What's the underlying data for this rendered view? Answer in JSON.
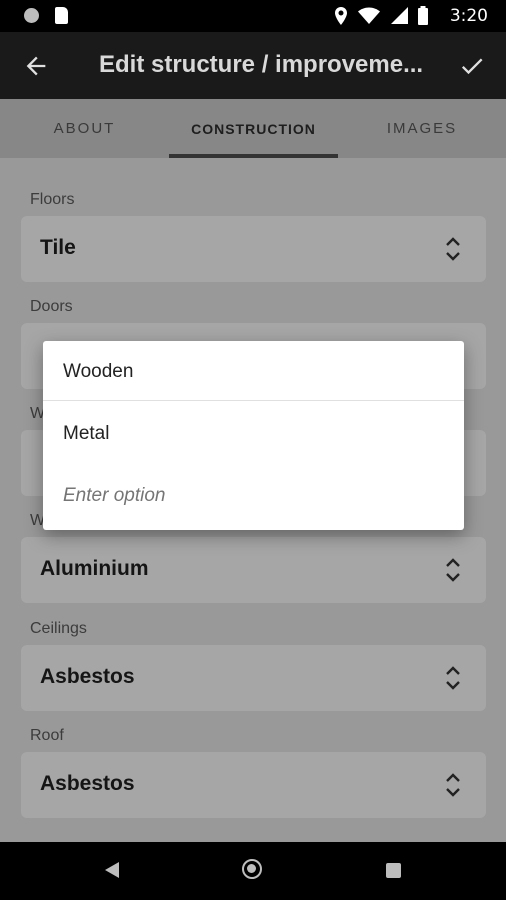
{
  "status_bar": {
    "time": "3:20"
  },
  "app_bar": {
    "title": "Edit structure / improveme..."
  },
  "tabs": [
    {
      "label": "ABOUT"
    },
    {
      "label": "CONSTRUCTION"
    },
    {
      "label": "IMAGES"
    }
  ],
  "fields": {
    "floors": {
      "label": "Floors",
      "value": "Tile"
    },
    "doors": {
      "label": "Doors",
      "value": ""
    },
    "walls": {
      "label": "W",
      "value": ""
    },
    "windows": {
      "label": "W",
      "value": "Aluminium"
    },
    "ceilings": {
      "label": "Ceilings",
      "value": "Asbestos"
    },
    "roof": {
      "label": "Roof",
      "value": "Asbestos"
    }
  },
  "dropdown": {
    "options": [
      "Wooden",
      "Metal"
    ],
    "input_placeholder": "Enter option"
  },
  "colors": {
    "app_bar_bg": "#1a1a1a",
    "tab_indicator": "#333333",
    "dialog_bg": "#ffffff"
  }
}
